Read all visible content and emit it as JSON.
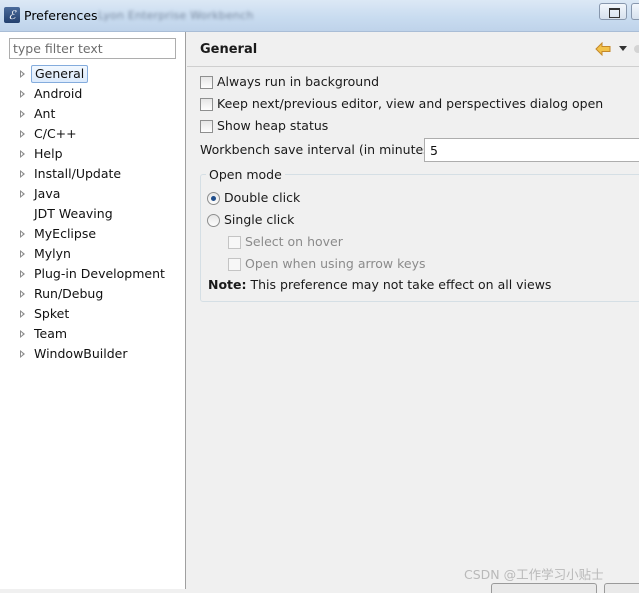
{
  "window": {
    "title": "Preferences",
    "background_title": "Lyon Enterprise Workbench"
  },
  "filter": {
    "placeholder": "type filter text",
    "value": ""
  },
  "tree": {
    "items": [
      {
        "label": "General",
        "expandable": true,
        "selected": true
      },
      {
        "label": "Android",
        "expandable": true
      },
      {
        "label": "Ant",
        "expandable": true
      },
      {
        "label": "C/C++",
        "expandable": true
      },
      {
        "label": "Help",
        "expandable": true
      },
      {
        "label": "Install/Update",
        "expandable": true
      },
      {
        "label": "Java",
        "expandable": true
      },
      {
        "label": "JDT Weaving",
        "expandable": false
      },
      {
        "label": "MyEclipse",
        "expandable": true
      },
      {
        "label": "Mylyn",
        "expandable": true
      },
      {
        "label": "Plug-in Development",
        "expandable": true
      },
      {
        "label": "Run/Debug",
        "expandable": true
      },
      {
        "label": "Spket",
        "expandable": true
      },
      {
        "label": "Team",
        "expandable": true
      },
      {
        "label": "WindowBuilder",
        "expandable": true
      }
    ]
  },
  "page": {
    "title": "General",
    "options": {
      "always_run_background": {
        "label": "Always run in background",
        "checked": false
      },
      "keep_dialog_open": {
        "label": "Keep next/previous editor, view and perspectives dialog open",
        "checked": false
      },
      "show_heap_status": {
        "label": "Show heap status",
        "checked": false
      }
    },
    "save_interval": {
      "label": "Workbench save interval (in minutes):",
      "value": "5"
    },
    "open_mode": {
      "title": "Open mode",
      "double_click": {
        "label": "Double click",
        "selected": true
      },
      "single_click": {
        "label": "Single click",
        "selected": false
      },
      "select_on_hover": {
        "label": "Select on hover",
        "checked": false,
        "enabled": false
      },
      "open_arrow_keys": {
        "label": "Open when using arrow keys",
        "checked": false,
        "enabled": false
      }
    },
    "note": {
      "prefix": "Note:",
      "text": "This preference may not take effect on all views"
    }
  },
  "watermark": "CSDN @工作学习小贴士",
  "colors": {
    "selection_border": "#84acdd",
    "selection_fill": "#dbeafc",
    "back_arrow": "#e8a93b",
    "radio_dot": "#1f4d8a"
  }
}
